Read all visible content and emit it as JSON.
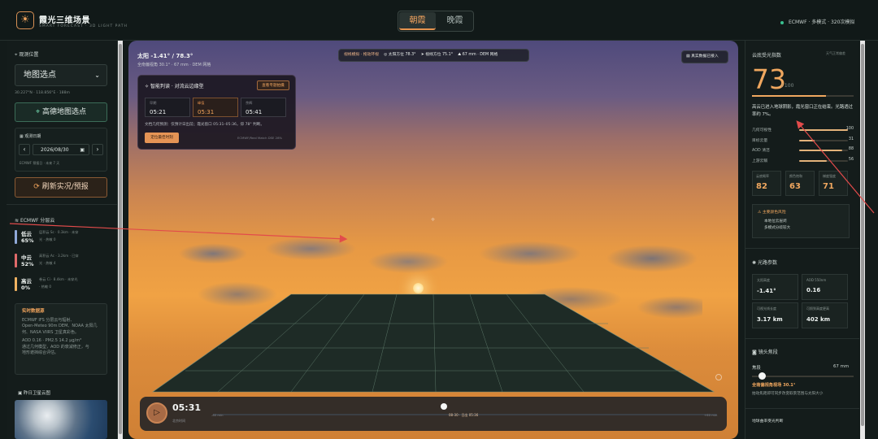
{
  "header": {
    "title": "霞光三维场景",
    "subtitle": "SMART FORECAST · 3D LIGHT PATH",
    "tabs": [
      {
        "label": "朝霞",
        "active": true
      },
      {
        "label": "晚霞",
        "active": false
      }
    ],
    "status": "ECMWF · 多模式 · 320次模拟",
    "status_color": "#39c08f"
  },
  "left": {
    "location_label": "观测位置",
    "location_select": "地图选点",
    "coords": "30.227°N · 118.856°E · 188m",
    "map_button": "高德地图选点",
    "date_label": "观测日期",
    "date_value": "2026/08/30",
    "date_hint": "ECMWF 预报日 · 未来 7 天",
    "refresh_button": "刷新实况/预报",
    "layers_title": "ECMWF 分层云",
    "layers": [
      {
        "name": "低云",
        "pct": "65%",
        "desc": "层积云 Sc · 0.3km · 未穿",
        "desc2": "光 · 热敏 0",
        "color": "#8fa8d8"
      },
      {
        "name": "中云",
        "pct": "52%",
        "desc": "高积云 Ac · 3.2km · 已穿",
        "desc2": "光 · 热敏 4",
        "color": "#e06a6a"
      },
      {
        "name": "高云",
        "pct": "0%",
        "desc": "卷云 Ci · 8.4km · 未穿光",
        "desc2": "· 热敏 0",
        "color": "#f0b261"
      }
    ],
    "info_title": "实时数据源",
    "info_lines": [
      "ECMWF IFS 分层云与辐射、",
      "Open-Meteo 90m DEM、NOAA 太阳几",
      "何、NASA VIIRS 卫星真彩色。",
      "AOD 0.16 · PM2.5 14.2 μg/m³",
      "通过几何模型，AOD 的衰减修正，与",
      "地形遮挡综合评估。"
    ],
    "satellite_label": "昨日卫星云图"
  },
  "scene": {
    "sun_title": "太阳 -1.41° / 78.3°",
    "sun_sub": "全南偏视角 30.1° · 67 mm · DEM 网格",
    "toolbar": [
      "视线模拟 · 拖动环视",
      "太阳方位 78.3°",
      "视线方位 75.1°",
      "67 mm · DEM 网格"
    ],
    "realtime": "真实数据已接入",
    "card_title": "智能判读 · 对流云边缘型",
    "card_btn": "查看专题拍摄",
    "times": [
      {
        "k": "早期",
        "v": "05:21"
      },
      {
        "k": "峰值",
        "v": "05:31"
      },
      {
        "k": "余辉",
        "v": "05:41"
      }
    ],
    "card_text": "文档几何预测：仅预计日出前；霞光窗口 05:31–05:36，仰 78° 判断。",
    "card_btn2": "定位最佳时刻",
    "card_note": "ECMWF/Real Match DSE 28%",
    "play_time": "05:31",
    "play_sub": "北京时间",
    "play_left": "-60 min",
    "play_mid": "08-30 · 日出 05:36",
    "play_right": "+60 min"
  },
  "right": {
    "score_label": "云底受光指数",
    "score_tag": "天气正常偏差",
    "score": "73",
    "score_max": "/ 100",
    "score_desc": "高云已进入地球阴影，霞光窗口正在结束。光路透过率约 7%。",
    "bars": [
      {
        "k": "几何可视性",
        "v": 100
      },
      {
        "k": "目标云量",
        "v": 31
      },
      {
        "k": "AOD 清洁",
        "v": 88
      },
      {
        "k": "上游云翳",
        "v": 56
      }
    ],
    "subscores": [
      {
        "k": "云底概率",
        "v": "82"
      },
      {
        "k": "颜色饱和",
        "v": "63"
      },
      {
        "k": "梯度强度",
        "v": "71"
      }
    ],
    "alert_title": "主要颜色风险",
    "alert_lines": [
      "本地位云层闭",
      "多模式分歧较大"
    ],
    "light_title": "光路参数",
    "params": [
      {
        "k": "太阳高度",
        "v": "-1.41°"
      },
      {
        "k": "AOD 550nm",
        "v": "0.16"
      },
      {
        "k": "可视光线长度",
        "v": "3.17 km"
      },
      {
        "k": "可照到高度更高",
        "v": "402 km"
      }
    ],
    "lens_title": "镜头焦段",
    "focal_label": "焦段",
    "focal_value": "67 mm",
    "lens_note": "全南偏视角视场 30.1°",
    "lens_desc": "拍动焦距即可同步改变取景范围与太阳大小",
    "bottom_label": "地球曲率受光判断"
  }
}
